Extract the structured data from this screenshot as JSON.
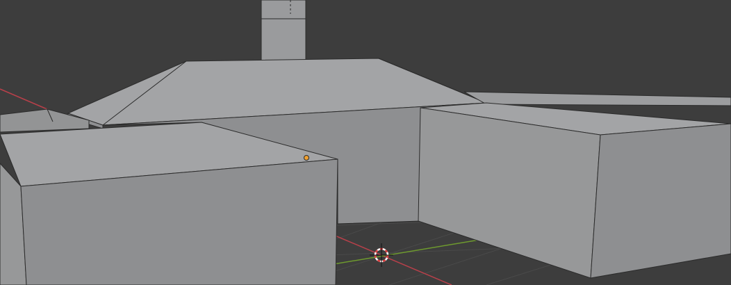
{
  "viewport": {
    "background": "#3d3d3d",
    "grid_color": "#4a4a4a",
    "x_axis_color": "#b8404a",
    "y_axis_color": "#6e9a2e",
    "object_face_colors": {
      "top": "#a3a4a6",
      "front": "#8e8f91",
      "side": "#979899",
      "edge": "#2b2b2b"
    },
    "origin_point_color": "#f0a030",
    "cursor_colors": [
      "#d83c3c",
      "#ffffff"
    ]
  },
  "icons": {
    "cursor": "3d-cursor-icon",
    "origin": "object-origin-icon"
  }
}
